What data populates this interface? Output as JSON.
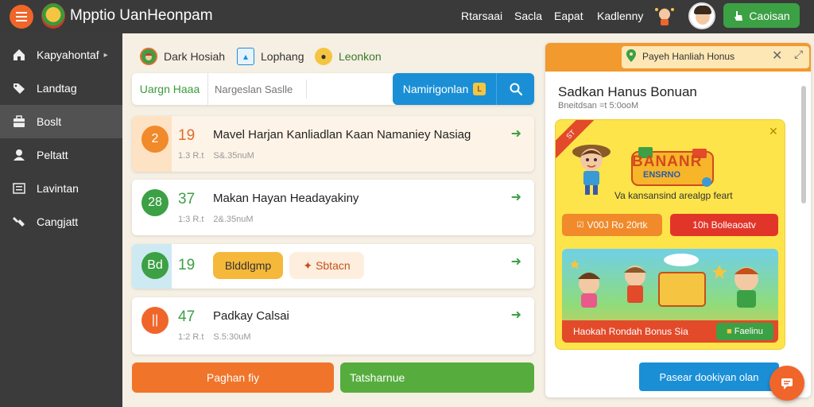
{
  "app": {
    "title": "Mpptio UanHeonpam"
  },
  "topbar": {
    "nav": [
      "Rtarsaai",
      "Sacla",
      "Eapat",
      "Kadlenny"
    ],
    "cta_label": "Caoisan"
  },
  "sidebar": {
    "items": [
      {
        "label": "Kapyahontaf",
        "icon": "home-icon"
      },
      {
        "label": "Landtag",
        "icon": "folder-icon"
      },
      {
        "label": "Boslt",
        "icon": "briefcase-icon"
      },
      {
        "label": "Peltatt",
        "icon": "user-icon"
      },
      {
        "label": "Lavintan",
        "icon": "list-icon"
      },
      {
        "label": "Cangjatt",
        "icon": "tools-icon"
      }
    ]
  },
  "filters": [
    "Dark Hosiah",
    "Lophang",
    "Leonkon"
  ],
  "search": {
    "category": "Uargn Haaa",
    "placeholder": "Nargeslan Saslle",
    "button": "Namirigonlan",
    "button_badge": "L"
  },
  "cards": [
    {
      "lead": "2",
      "num": "19",
      "title": "Mavel Harjan Kanliadlan Kaan Namaniey Nasiag",
      "meta": [
        "1.3 R.t",
        "S&.35nuM"
      ]
    },
    {
      "lead": "28",
      "num": "37",
      "title": "Makan Hayan Headayakiny",
      "meta": [
        "1:3 R.t",
        "2&.35nuM"
      ]
    },
    {
      "lead": "Bd",
      "num": "19",
      "chips": [
        "Blddlgmp",
        "Sbtacn"
      ]
    },
    {
      "lead": "||",
      "num": "47",
      "title": "Padkay Calsai",
      "meta": [
        "1:2 R.t",
        "S.5:30uM"
      ]
    }
  ],
  "bottom": {
    "primary": "Paghan fiy",
    "secondary": "Tatsharnue"
  },
  "panel": {
    "head_title": "Payeh Hanliah Honus",
    "title": "Sadkan Hanus Bonuan",
    "subtitle": "Bneitdsan =t 5:0ooM",
    "promo": {
      "ribbon": "ST",
      "logo_text": "BANANR",
      "logo_sub": "ENSRNO",
      "tagline": "Va kansansind arealgp feart",
      "btn_left": "V00J Ro 20rtk",
      "btn_right": "10h Bolleaoatv",
      "scene_text": "Haokah Rondah Bonus Sia",
      "scene_btn": "Faelinu"
    },
    "cta": "Pasear dookiyan olan"
  },
  "colors": {
    "orange": "#f0652a",
    "green": "#3ca045",
    "blue": "#1a8fd6",
    "dark": "#3a3a3a"
  }
}
